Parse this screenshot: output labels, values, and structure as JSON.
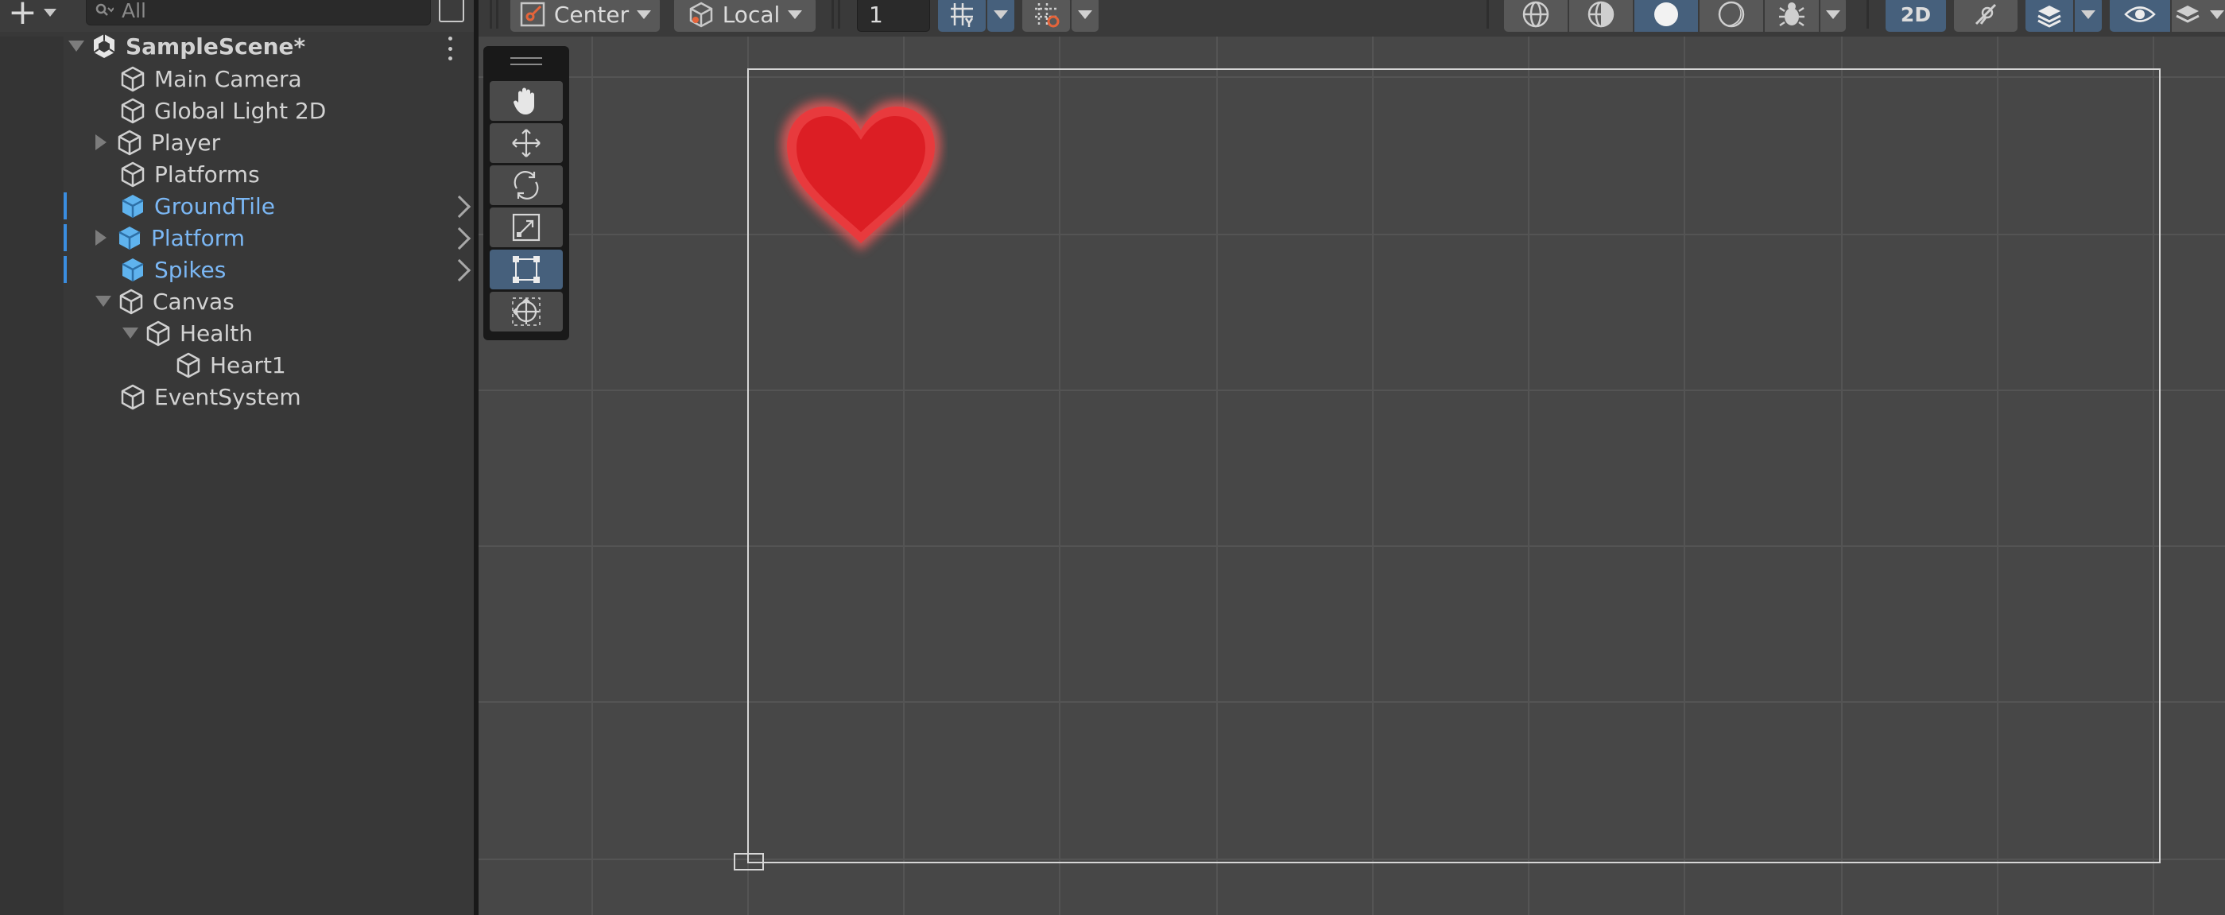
{
  "hierarchy": {
    "search_placeholder": "All",
    "scene_name": "SampleScene*",
    "items": [
      {
        "label": "Main Camera"
      },
      {
        "label": "Global Light 2D"
      },
      {
        "label": "Player"
      },
      {
        "label": "Platforms"
      },
      {
        "label": "GroundTile"
      },
      {
        "label": "Platform"
      },
      {
        "label": "Spikes"
      },
      {
        "label": "Canvas"
      },
      {
        "label": "Health"
      },
      {
        "label": "Heart1"
      },
      {
        "label": "EventSystem"
      }
    ]
  },
  "scene_toolbar": {
    "pivot_label": "Center",
    "space_label": "Local",
    "snap_value": "1",
    "mode_2d_label": "2D"
  },
  "colors": {
    "accent": "#46607c",
    "prefab_text": "#7bb7f4",
    "heart": "#e01e24"
  },
  "icons": {
    "tools": [
      "hand-icon",
      "move-icon",
      "rotate-icon",
      "scale-icon",
      "rect-icon",
      "transform-icon"
    ]
  }
}
